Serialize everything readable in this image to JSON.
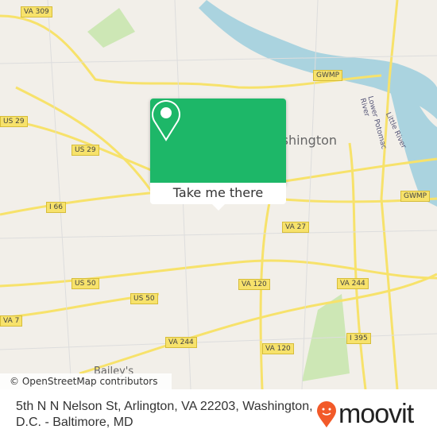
{
  "map": {
    "road_labels": [
      "VA 309",
      "US 29",
      "US 29",
      "GWMP",
      "GWMP",
      "I 66",
      "US 50",
      "US 50",
      "VA 27",
      "VA 120",
      "VA 120",
      "VA 244",
      "VA 244",
      "VA 7",
      "I 395"
    ],
    "places": {
      "city": "Washington",
      "neighborhood": "Bailey's",
      "river": "Lower Potomac River",
      "river2": "Little River"
    },
    "attribution": "© OpenStreetMap contributors",
    "colors": {
      "land": "#f2efe9",
      "water": "#aad3df",
      "road": "#f7e26b",
      "park": "#cde7b5"
    }
  },
  "popup": {
    "icon": "map-pin-icon",
    "button_label": "Take me there",
    "color": "#1db768"
  },
  "footer": {
    "address": "5th N N Nelson St, Arlington, VA 22203, Washington, D.C. - Baltimore, MD",
    "brand": "moovit",
    "brand_color": "#f25a29"
  }
}
